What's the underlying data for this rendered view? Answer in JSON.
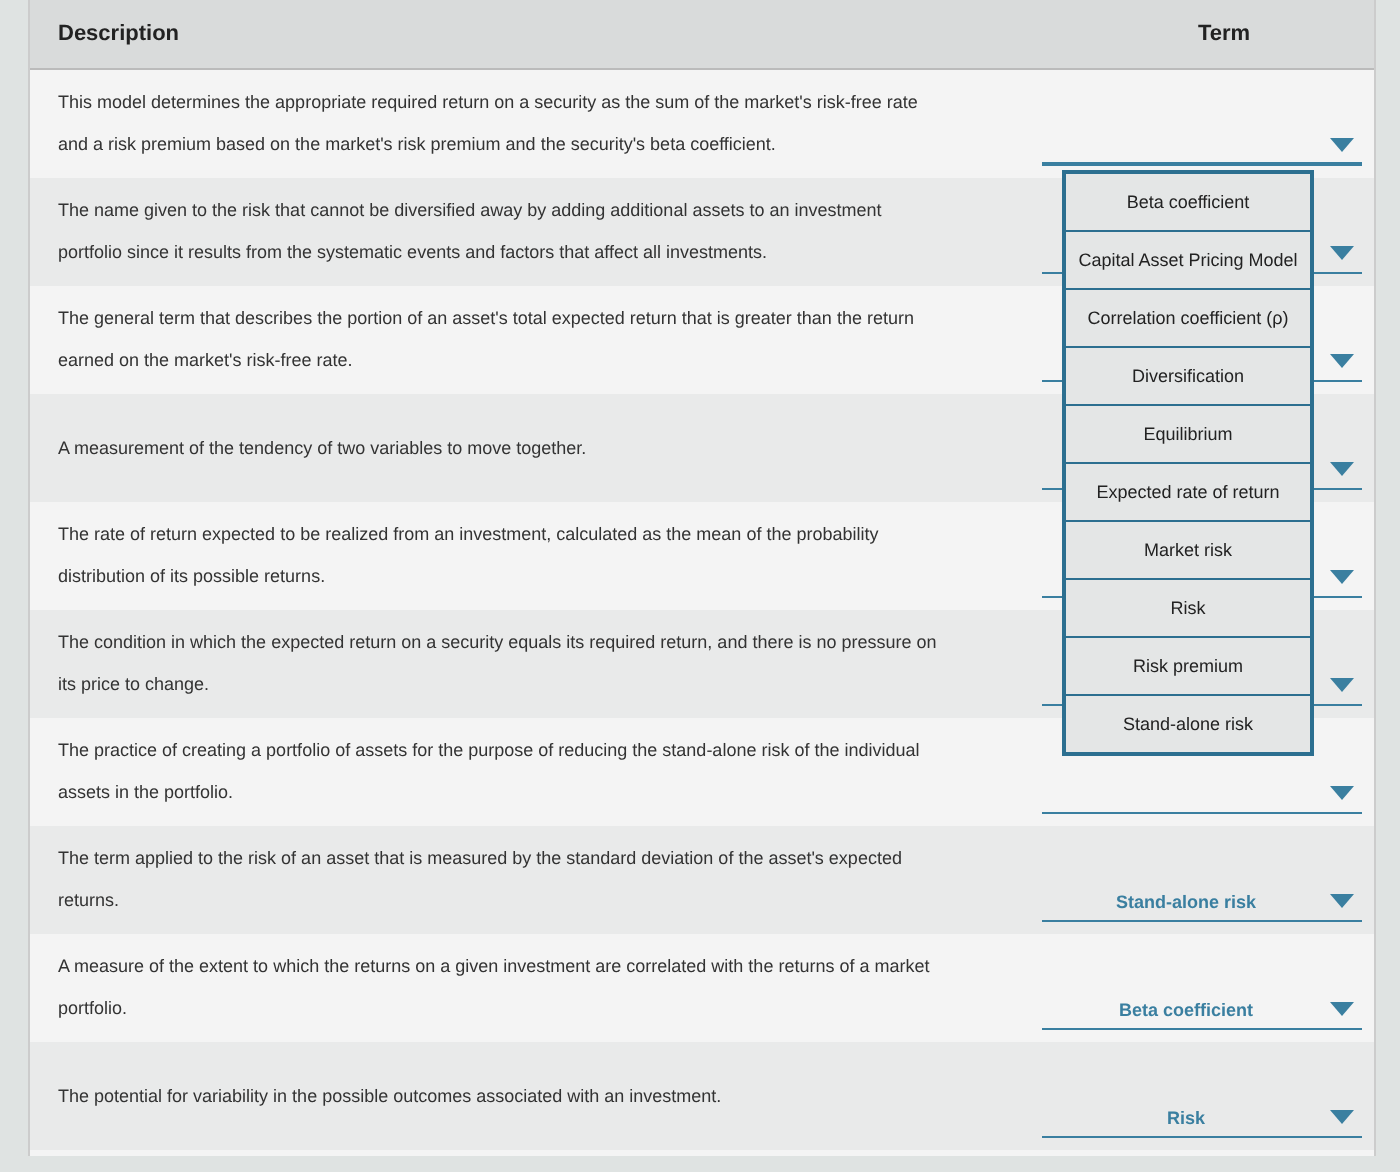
{
  "header": {
    "description": "Description",
    "term": "Term"
  },
  "rows": [
    {
      "description": "This model determines the appropriate required return on a security as the sum of the market's risk-free rate and a risk premium based on the market's risk premium and the security's beta coefficient.",
      "menu": [
        "Beta coefficient",
        "Capital Asset Pricing Model",
        "Correlation coefficient (ρ)",
        "Diversification",
        "Equilibrium",
        "Expected rate of return",
        "Market risk",
        "Risk",
        "Risk premium",
        "Stand-alone risk"
      ]
    },
    {
      "description": "The name given to the risk that cannot be diversified away by adding additional assets to an investment portfolio since it results from the systematic events and factors that affect all investments."
    },
    {
      "description": "The general term that describes the portion of an asset's total expected return that is greater than the return earned on the market's risk-free rate."
    },
    {
      "description": "A measurement of the tendency of two variables to move together."
    },
    {
      "description": "The rate of return expected to be realized from an investment, calculated as the mean of the probability distribution of its possible returns."
    },
    {
      "description": "The condition in which the expected return on a security equals its required return, and there is no pressure on its price to change."
    },
    {
      "description": "The practice of creating a portfolio of assets for the purpose of reducing the stand-alone risk of the individual assets in the portfolio."
    },
    {
      "description": "The term applied to the risk of an asset that is measured by the standard deviation of the asset's expected returns.",
      "value": "Stand-alone risk"
    },
    {
      "description": "A measure of the extent to which the returns on a given investment are correlated with the returns of a market portfolio.",
      "value": "Beta coefficient"
    },
    {
      "description": "The potential for variability in the possible outcomes associated with an investment.",
      "value": "Risk"
    }
  ]
}
